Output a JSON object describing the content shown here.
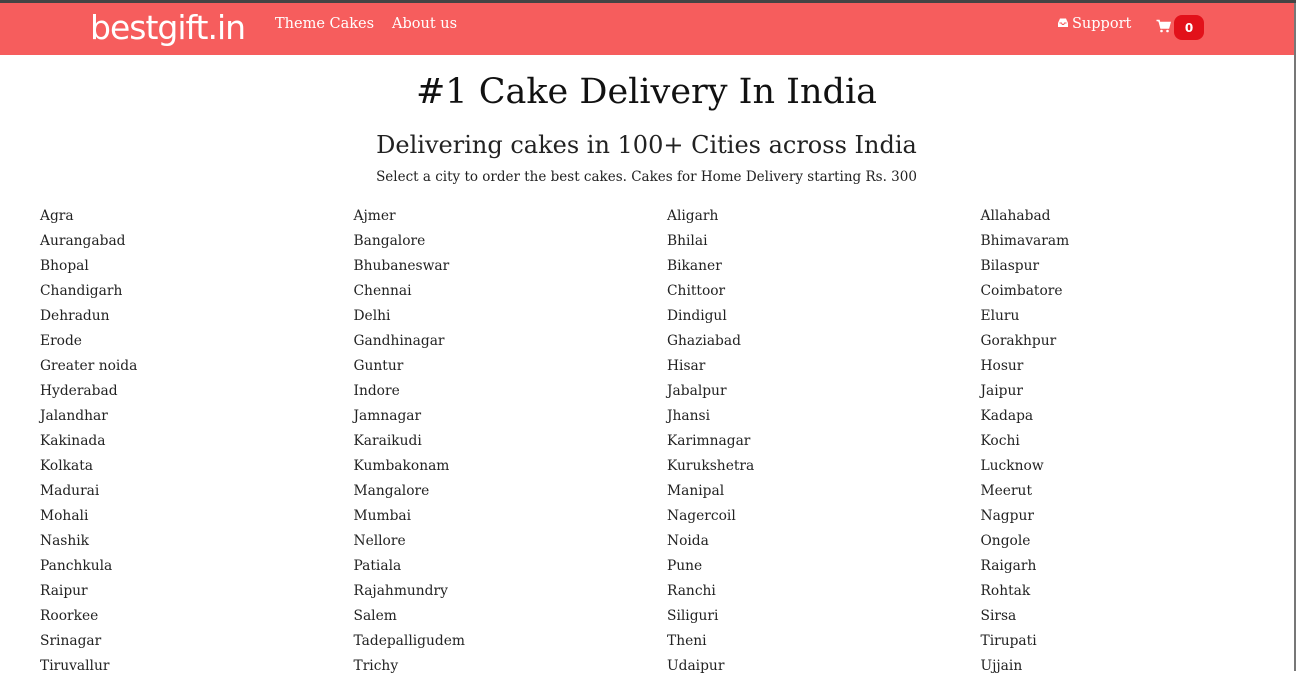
{
  "nav": {
    "logo": "bestgift.in",
    "links": [
      "Theme Cakes",
      "About us"
    ],
    "support": "Support",
    "support_icon": "inbox-icon",
    "cart_icon": "shopping-cart-icon",
    "cart_count": "0"
  },
  "colors": {
    "navbar": "#f65d5d",
    "cart_badge": "#e2111a"
  },
  "hero": {
    "title": "#1 Cake Delivery In India",
    "subtitle": "Delivering cakes in 100+ Cities across India",
    "tagline": "Select a city to order the best cakes. Cakes for Home Delivery starting Rs. 300"
  },
  "cities": [
    "Agra",
    "Ajmer",
    "Aligarh",
    "Allahabad",
    "Aurangabad",
    "Bangalore",
    "Bhilai",
    "Bhimavaram",
    "Bhopal",
    "Bhubaneswar",
    "Bikaner",
    "Bilaspur",
    "Chandigarh",
    "Chennai",
    "Chittoor",
    "Coimbatore",
    "Dehradun",
    "Delhi",
    "Dindigul",
    "Eluru",
    "Erode",
    "Gandhinagar",
    "Ghaziabad",
    "Gorakhpur",
    "Greater noida",
    "Guntur",
    "Hisar",
    "Hosur",
    "Hyderabad",
    "Indore",
    "Jabalpur",
    "Jaipur",
    "Jalandhar",
    "Jamnagar",
    "Jhansi",
    "Kadapa",
    "Kakinada",
    "Karaikudi",
    "Karimnagar",
    "Kochi",
    "Kolkata",
    "Kumbakonam",
    "Kurukshetra",
    "Lucknow",
    "Madurai",
    "Mangalore",
    "Manipal",
    "Meerut",
    "Mohali",
    "Mumbai",
    "Nagercoil",
    "Nagpur",
    "Nashik",
    "Nellore",
    "Noida",
    "Ongole",
    "Panchkula",
    "Patiala",
    "Pune",
    "Raigarh",
    "Raipur",
    "Rajahmundry",
    "Ranchi",
    "Rohtak",
    "Roorkee",
    "Salem",
    "Siliguri",
    "Sirsa",
    "Srinagar",
    "Tadepalligudem",
    "Theni",
    "Tirupati",
    "Tiruvallur",
    "Trichy",
    "Udaipur",
    "Ujjain"
  ]
}
